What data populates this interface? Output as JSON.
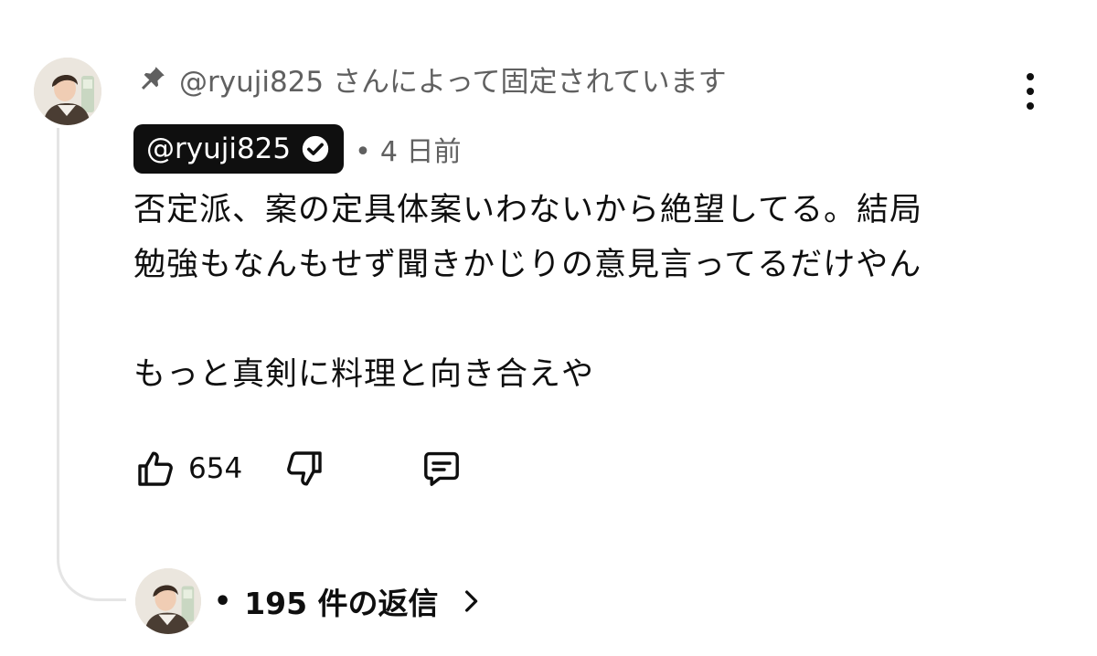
{
  "pinned": {
    "icon": "pin-icon",
    "text": "@ryuji825 さんによって固定されています"
  },
  "comment": {
    "author": "@ryuji825",
    "verified_icon": "verified-check-icon",
    "meta_separator": "•",
    "timestamp": "4 日前",
    "lines": [
      "否定派、案の定具体案いわないから絶望してる。結局",
      "勉強もなんもせず聞きかじりの意見言ってるだけやん",
      "",
      "もっと真剣に料理と向き合えや"
    ]
  },
  "actions": {
    "like_icon": "thumbs-up-icon",
    "like_count": "654",
    "dislike_icon": "thumbs-down-icon",
    "reply_icon": "reply-comment-icon"
  },
  "menu": {
    "icon": "more-vertical-icon"
  },
  "replies": {
    "dot": "•",
    "label": "195 件の返信",
    "chevron_icon": "chevron-right-icon"
  },
  "colors": {
    "text_primary": "#0f0f0f",
    "text_secondary": "#606060",
    "author_chip_bg": "#0f0f0f",
    "author_chip_text": "#ffffff",
    "thread_line": "#e5e5e5",
    "background": "#ffffff"
  }
}
